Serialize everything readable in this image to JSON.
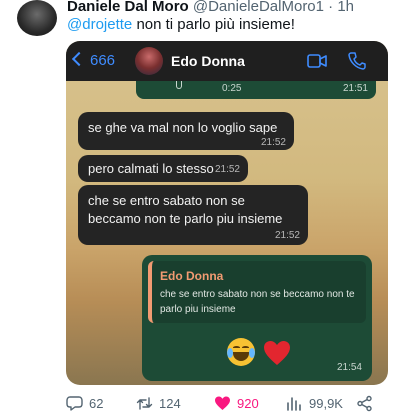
{
  "tweet": {
    "author_name": "Daniele Dal Moro",
    "author_handle": "@DanieleDalMoro1",
    "separator": "·",
    "time": "1h",
    "reply_mention": "@drojette",
    "reply_text": "non ti parlo più insieme!"
  },
  "whatsapp": {
    "back_count": "666",
    "contact_name": "Edo Donna",
    "prev_voice_duration": "0:25",
    "prev_time": "21:51",
    "messages_in": [
      {
        "text": "se ghe va mal non lo voglio sape",
        "time": "21:52"
      },
      {
        "text": "pero calmati lo stesso",
        "time": "21:52"
      },
      {
        "text": "che se entro sabato non se\nbeccamo non te parlo piu insieme",
        "time": "21:52"
      }
    ],
    "reply_out": {
      "quoted_name": "Edo Donna",
      "quoted_text": "che se entro sabato non se beccamo non te parlo piu insieme",
      "time": "21:54",
      "emojis": [
        "face-with-tears-of-joy",
        "red-heart"
      ]
    }
  },
  "actions": {
    "replies": "62",
    "retweets": "124",
    "likes": "920",
    "views": "99,9K"
  },
  "colors": {
    "mention": "#1d9bf0",
    "like": "#f91880",
    "whatsapp_outgoing": "#1d4b36",
    "quote_accent": "#f29b72"
  }
}
